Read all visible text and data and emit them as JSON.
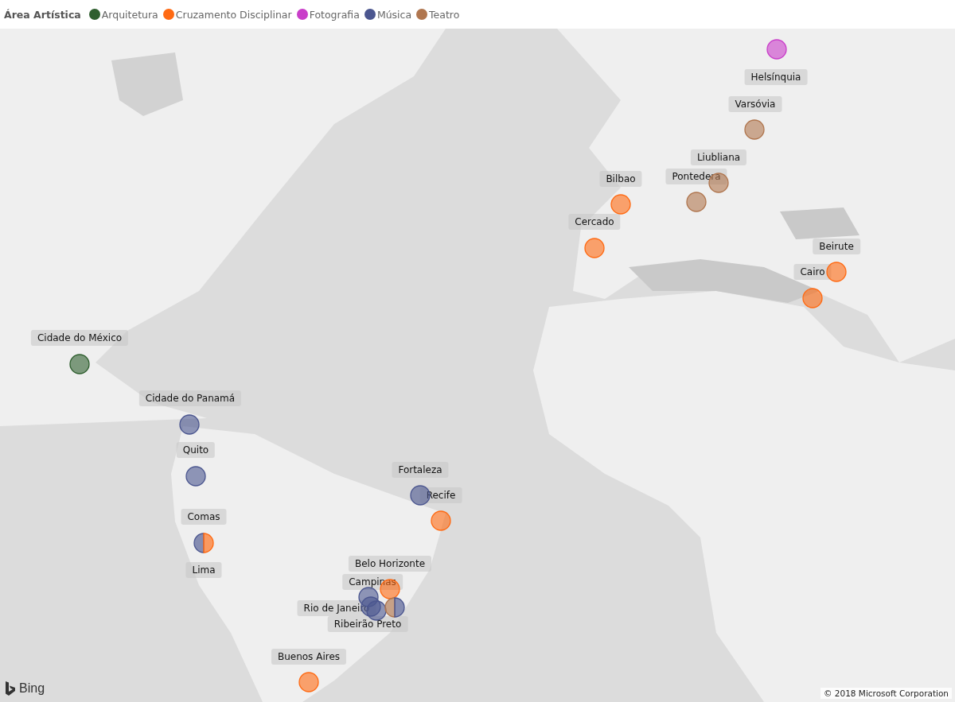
{
  "legend": {
    "title": "Área Artística",
    "items": [
      {
        "label": "Arquitetura",
        "color": "#2f5f2f"
      },
      {
        "label": "Cruzamento Disciplinar",
        "color": "#ff6a13"
      },
      {
        "label": "Fotografia",
        "color": "#c93ec9"
      },
      {
        "label": "Música",
        "color": "#4b568f"
      },
      {
        "label": "Teatro",
        "color": "#b0764f"
      }
    ]
  },
  "map": {
    "kind": "picture",
    "labels": [
      "Helsínquia",
      "Varsóvia",
      "Liubliana",
      "Pontedera",
      "Bilbao",
      "Cercado",
      "Beirute",
      "Cairo",
      "Cidade do México",
      "Cidade do Panamá",
      "Quito",
      "Fortaleza",
      "Recife",
      "Comas",
      "Lima",
      "Belo Horizonte",
      "Campinas",
      "Rio de Janeiro",
      "Ribeirão Preto",
      "Buenos Aires"
    ],
    "bubbles": [
      {
        "slices": [
          {
            "color": "#c93ec9"
          }
        ]
      },
      {
        "slices": [
          {
            "color": "#b0764f"
          }
        ]
      },
      {
        "slices": [
          {
            "color": "#b0764f"
          }
        ]
      },
      {
        "slices": [
          {
            "color": "#b0764f"
          }
        ]
      },
      {
        "slices": [
          {
            "color": "#ff6a13"
          }
        ]
      },
      {
        "slices": [
          {
            "color": "#ff6a13"
          }
        ]
      },
      {
        "slices": [
          {
            "color": "#ff6a13"
          }
        ]
      },
      {
        "slices": [
          {
            "color": "#ff6a13"
          }
        ]
      },
      {
        "slices": [
          {
            "color": "#2f5f2f"
          }
        ]
      },
      {
        "slices": [
          {
            "color": "#4b568f"
          }
        ]
      },
      {
        "slices": [
          {
            "color": "#4b568f"
          }
        ]
      },
      {
        "slices": [
          {
            "color": "#4b568f"
          }
        ]
      },
      {
        "slices": [
          {
            "color": "#ff6a13"
          }
        ]
      },
      {
        "slices": [
          {
            "color": "#4b568f"
          },
          {
            "color": "#ff6a13"
          }
        ]
      },
      {
        "slices": [
          {
            "color": "#ff6a13"
          }
        ]
      },
      {
        "slices": [
          {
            "color": "#4b568f"
          }
        ]
      },
      {
        "slices": [
          {
            "color": "#4b568f"
          }
        ]
      },
      {
        "slices": [
          {
            "color": "#4b568f"
          }
        ]
      },
      {
        "slices": [
          {
            "color": "#b0764f"
          },
          {
            "color": "#4b568f"
          }
        ]
      },
      {
        "slices": [
          {
            "color": "#ff6a13"
          }
        ]
      }
    ],
    "logo": "Bing",
    "copyright": "© 2018 Microsoft Corporation"
  }
}
